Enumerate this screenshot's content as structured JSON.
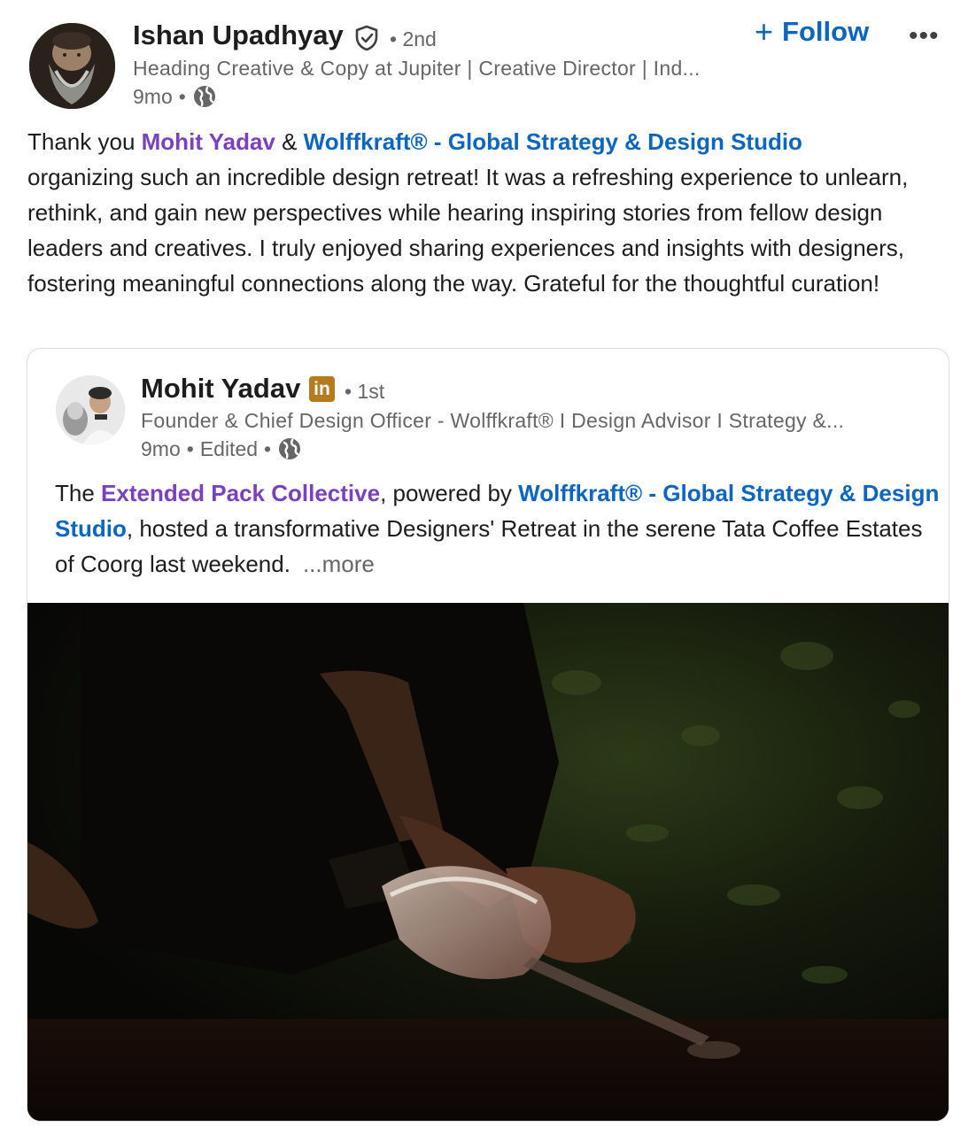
{
  "post": {
    "author": {
      "name": "Ishan Upadhyay",
      "degree": "• 2nd",
      "headline": "Heading Creative & Copy at Jupiter | Creative Director | Ind...",
      "time": "9mo",
      "visibility_icon": "globe-icon",
      "verified_icon": "verified-shield-icon"
    },
    "follow_label": "Follow",
    "more_label": "•••",
    "text": {
      "lead": "Thank you ",
      "mention_person": "Mohit Yadav",
      "amp": " & ",
      "mention_org": "Wolffkraft® - Global Strategy & Design Studio",
      "body": " organizing such an incredible design retreat! It was a refreshing experience to unlearn, rethink, and gain new perspectives while hearing inspiring stories from fellow design leaders and creatives. I truly enjoyed sharing experiences and insights with designers, fostering meaningful connections along the way. Grateful for the thoughtful curation!"
    }
  },
  "reshare": {
    "author": {
      "name": "Mohit Yadav",
      "badge": "in",
      "degree": "• 1st",
      "headline": "Founder & Chief Design Officer - Wolffkraft® I Design Advisor I Strategy &...",
      "time": "9mo",
      "edited": "Edited",
      "visibility_icon": "globe-icon"
    },
    "text": {
      "lead": "The ",
      "mention_collective": "Extended Pack Collective",
      "mid": ", powered by ",
      "mention_org": "Wolffkraft® - Global Strategy & Design Studio",
      "body": ", hosted a transformative Designers' Retreat in the serene Tata Coffee Estates of Coorg last weekend.",
      "more": "...more"
    },
    "media": "dark photo of hands holding a champagne glass being filled from a bottle"
  },
  "colors": {
    "link_blue": "#0a66c2",
    "mention_purple": "#7b3fc1",
    "muted": "#666666",
    "badge_gold": "#b57b1d"
  }
}
